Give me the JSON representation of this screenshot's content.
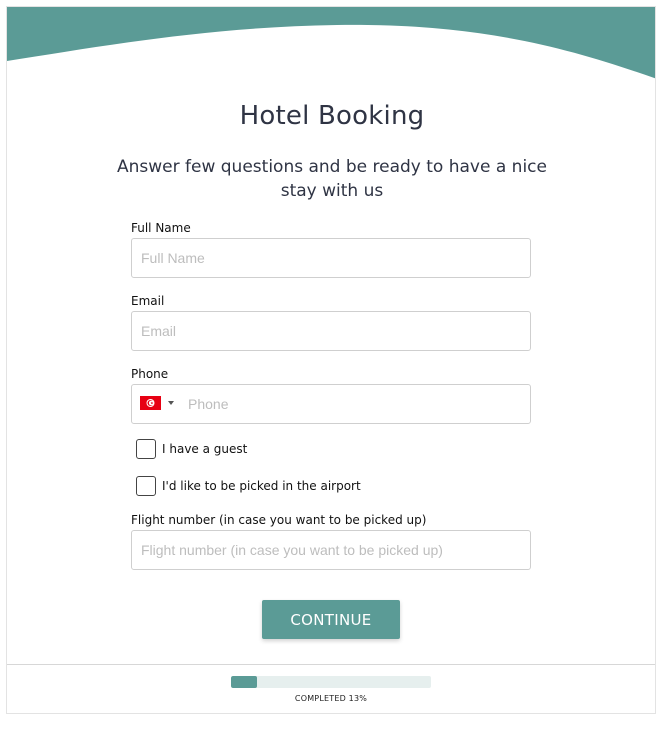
{
  "colors": {
    "accent": "#5b9b96",
    "flag_red": "#e70013"
  },
  "header": {
    "title": "Hotel Booking",
    "subtitle_line1": "Answer few questions and be ready to have a nice",
    "subtitle_line2": "stay with us"
  },
  "form": {
    "full_name": {
      "label": "Full Name",
      "placeholder": "Full Name",
      "value": ""
    },
    "email": {
      "label": "Email",
      "placeholder": "Email",
      "value": ""
    },
    "phone": {
      "label": "Phone",
      "placeholder": "Phone",
      "value": "",
      "country_flag_icon": "tunisia-flag-icon"
    },
    "guest_checkbox": {
      "label": "I have a guest",
      "checked": false
    },
    "pickup_checkbox": {
      "label": "I'd like to be picked in the airport",
      "checked": false
    },
    "flight_number": {
      "label": "Flight number (in case you want to be picked up)",
      "placeholder": "Flight number (in case you want to be picked up)",
      "value": ""
    },
    "continue_label": "CONTINUE"
  },
  "progress": {
    "percent": 13,
    "text": "COMPLETED 13%"
  }
}
